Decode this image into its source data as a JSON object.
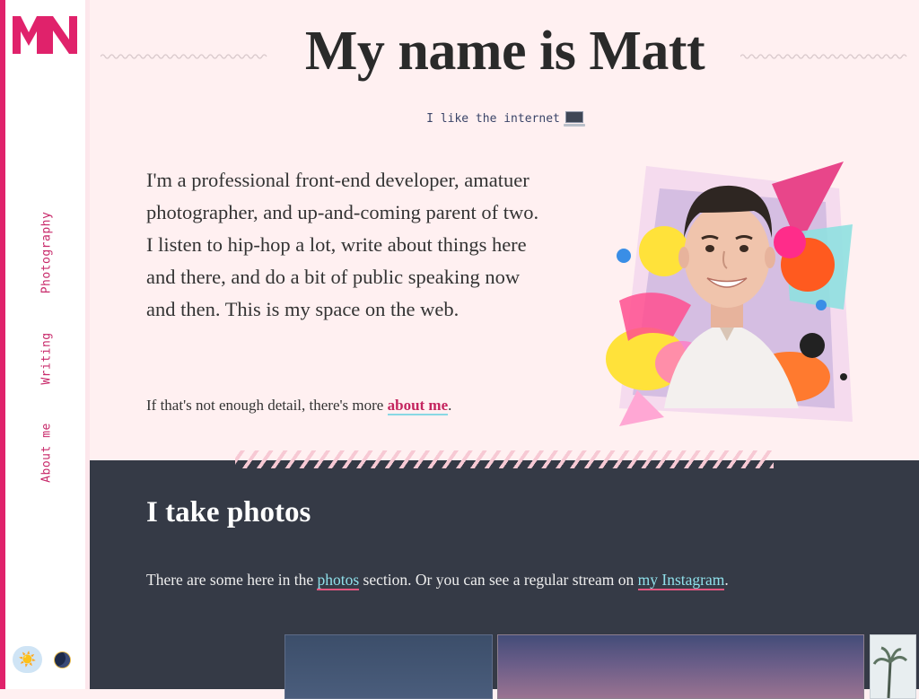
{
  "sidebar": {
    "logo_text": "MN",
    "nav": [
      "Photography",
      "Writing",
      "About me"
    ],
    "theme_light_icon": "sun-icon",
    "theme_dark_icon": "moon-icon"
  },
  "header": {
    "title": "My name is Matt",
    "tagline": "I like the internet",
    "tagline_icon": "laptop-icon"
  },
  "intro": {
    "text": "I'm a professional front-end developer, amatuer photographer, and up-and-coming parent of two. I listen to hip-hop a lot, write about things here and there, and do a bit of public speaking now and then. This is my space on the web.",
    "more_prefix": "If that's not enough detail, there's more ",
    "more_link": "about me",
    "more_suffix": "."
  },
  "photos": {
    "heading": "I take photos",
    "text_before": "There are some here in the ",
    "link_photos": "photos",
    "text_middle": " section. Or you can see a regular stream on ",
    "link_instagram": "my Instagram",
    "text_after": "."
  },
  "colors": {
    "accent": "#e0226b",
    "background": "#fff0f1",
    "dark_section": "#353a46",
    "link_underline": "#88d8e4"
  }
}
